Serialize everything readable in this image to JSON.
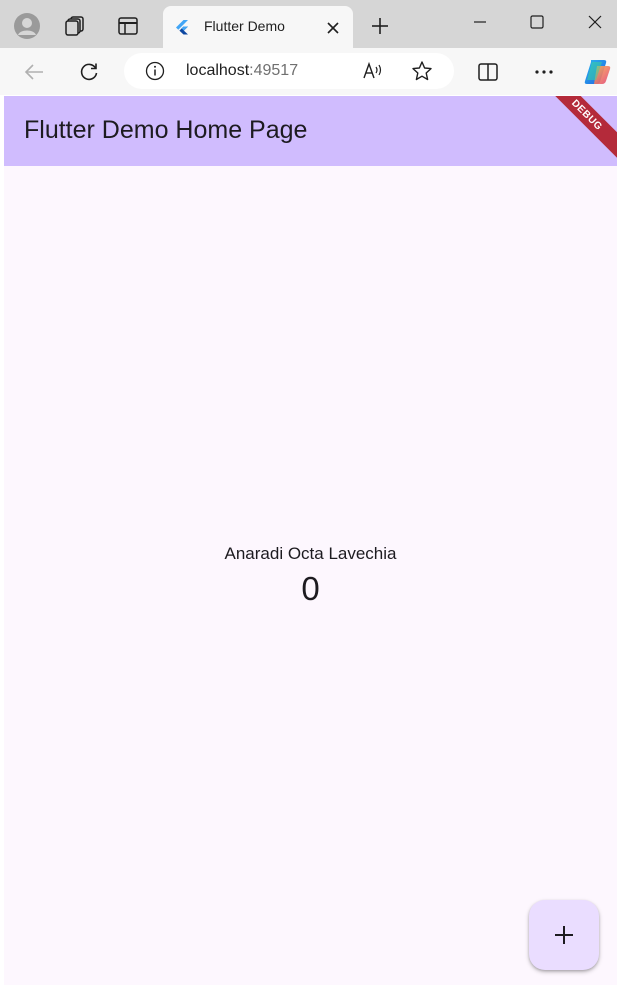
{
  "browser": {
    "tab": {
      "title": "Flutter Demo"
    },
    "address_bar": {
      "host": "localhost",
      "port": ":49517"
    }
  },
  "app": {
    "appbar_title": "Flutter Demo Home Page",
    "debug_banner": "DEBUG",
    "center_label": "Anaradi Octa Lavechia",
    "counter_value": "0",
    "colors": {
      "appbar": "#d0bcfe",
      "background": "#fdf7fe",
      "fab": "#eaddff",
      "debug_banner": "#b42a3a"
    }
  },
  "icons": {
    "profile": "profile-icon",
    "workspaces": "workspaces-icon",
    "tab_actions": "tab-actions-icon",
    "favicon": "flutter-logo-icon",
    "tab_close": "close-icon",
    "new_tab": "plus-icon",
    "minimize": "minimize-icon",
    "maximize": "maximize-icon",
    "close_window": "close-icon",
    "back": "back-arrow-icon",
    "refresh": "refresh-icon",
    "site_info": "info-icon",
    "read_aloud": "read-aloud-icon",
    "favorite": "star-icon",
    "split_screen": "split-screen-icon",
    "more": "more-icon",
    "copilot": "copilot-icon",
    "fab": "plus-icon"
  }
}
